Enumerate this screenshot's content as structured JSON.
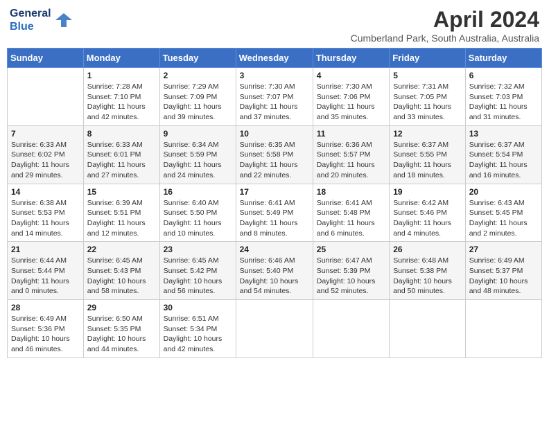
{
  "header": {
    "logo_line1": "General",
    "logo_line2": "Blue",
    "month_title": "April 2024",
    "location": "Cumberland Park, South Australia, Australia"
  },
  "days_of_week": [
    "Sunday",
    "Monday",
    "Tuesday",
    "Wednesday",
    "Thursday",
    "Friday",
    "Saturday"
  ],
  "weeks": [
    [
      {
        "day": "",
        "info": ""
      },
      {
        "day": "1",
        "info": "Sunrise: 7:28 AM\nSunset: 7:10 PM\nDaylight: 11 hours\nand 42 minutes."
      },
      {
        "day": "2",
        "info": "Sunrise: 7:29 AM\nSunset: 7:09 PM\nDaylight: 11 hours\nand 39 minutes."
      },
      {
        "day": "3",
        "info": "Sunrise: 7:30 AM\nSunset: 7:07 PM\nDaylight: 11 hours\nand 37 minutes."
      },
      {
        "day": "4",
        "info": "Sunrise: 7:30 AM\nSunset: 7:06 PM\nDaylight: 11 hours\nand 35 minutes."
      },
      {
        "day": "5",
        "info": "Sunrise: 7:31 AM\nSunset: 7:05 PM\nDaylight: 11 hours\nand 33 minutes."
      },
      {
        "day": "6",
        "info": "Sunrise: 7:32 AM\nSunset: 7:03 PM\nDaylight: 11 hours\nand 31 minutes."
      }
    ],
    [
      {
        "day": "7",
        "info": "Sunrise: 6:33 AM\nSunset: 6:02 PM\nDaylight: 11 hours\nand 29 minutes."
      },
      {
        "day": "8",
        "info": "Sunrise: 6:33 AM\nSunset: 6:01 PM\nDaylight: 11 hours\nand 27 minutes."
      },
      {
        "day": "9",
        "info": "Sunrise: 6:34 AM\nSunset: 5:59 PM\nDaylight: 11 hours\nand 24 minutes."
      },
      {
        "day": "10",
        "info": "Sunrise: 6:35 AM\nSunset: 5:58 PM\nDaylight: 11 hours\nand 22 minutes."
      },
      {
        "day": "11",
        "info": "Sunrise: 6:36 AM\nSunset: 5:57 PM\nDaylight: 11 hours\nand 20 minutes."
      },
      {
        "day": "12",
        "info": "Sunrise: 6:37 AM\nSunset: 5:55 PM\nDaylight: 11 hours\nand 18 minutes."
      },
      {
        "day": "13",
        "info": "Sunrise: 6:37 AM\nSunset: 5:54 PM\nDaylight: 11 hours\nand 16 minutes."
      }
    ],
    [
      {
        "day": "14",
        "info": "Sunrise: 6:38 AM\nSunset: 5:53 PM\nDaylight: 11 hours\nand 14 minutes."
      },
      {
        "day": "15",
        "info": "Sunrise: 6:39 AM\nSunset: 5:51 PM\nDaylight: 11 hours\nand 12 minutes."
      },
      {
        "day": "16",
        "info": "Sunrise: 6:40 AM\nSunset: 5:50 PM\nDaylight: 11 hours\nand 10 minutes."
      },
      {
        "day": "17",
        "info": "Sunrise: 6:41 AM\nSunset: 5:49 PM\nDaylight: 11 hours\nand 8 minutes."
      },
      {
        "day": "18",
        "info": "Sunrise: 6:41 AM\nSunset: 5:48 PM\nDaylight: 11 hours\nand 6 minutes."
      },
      {
        "day": "19",
        "info": "Sunrise: 6:42 AM\nSunset: 5:46 PM\nDaylight: 11 hours\nand 4 minutes."
      },
      {
        "day": "20",
        "info": "Sunrise: 6:43 AM\nSunset: 5:45 PM\nDaylight: 11 hours\nand 2 minutes."
      }
    ],
    [
      {
        "day": "21",
        "info": "Sunrise: 6:44 AM\nSunset: 5:44 PM\nDaylight: 11 hours\nand 0 minutes."
      },
      {
        "day": "22",
        "info": "Sunrise: 6:45 AM\nSunset: 5:43 PM\nDaylight: 10 hours\nand 58 minutes."
      },
      {
        "day": "23",
        "info": "Sunrise: 6:45 AM\nSunset: 5:42 PM\nDaylight: 10 hours\nand 56 minutes."
      },
      {
        "day": "24",
        "info": "Sunrise: 6:46 AM\nSunset: 5:40 PM\nDaylight: 10 hours\nand 54 minutes."
      },
      {
        "day": "25",
        "info": "Sunrise: 6:47 AM\nSunset: 5:39 PM\nDaylight: 10 hours\nand 52 minutes."
      },
      {
        "day": "26",
        "info": "Sunrise: 6:48 AM\nSunset: 5:38 PM\nDaylight: 10 hours\nand 50 minutes."
      },
      {
        "day": "27",
        "info": "Sunrise: 6:49 AM\nSunset: 5:37 PM\nDaylight: 10 hours\nand 48 minutes."
      }
    ],
    [
      {
        "day": "28",
        "info": "Sunrise: 6:49 AM\nSunset: 5:36 PM\nDaylight: 10 hours\nand 46 minutes."
      },
      {
        "day": "29",
        "info": "Sunrise: 6:50 AM\nSunset: 5:35 PM\nDaylight: 10 hours\nand 44 minutes."
      },
      {
        "day": "30",
        "info": "Sunrise: 6:51 AM\nSunset: 5:34 PM\nDaylight: 10 hours\nand 42 minutes."
      },
      {
        "day": "",
        "info": ""
      },
      {
        "day": "",
        "info": ""
      },
      {
        "day": "",
        "info": ""
      },
      {
        "day": "",
        "info": ""
      }
    ]
  ]
}
